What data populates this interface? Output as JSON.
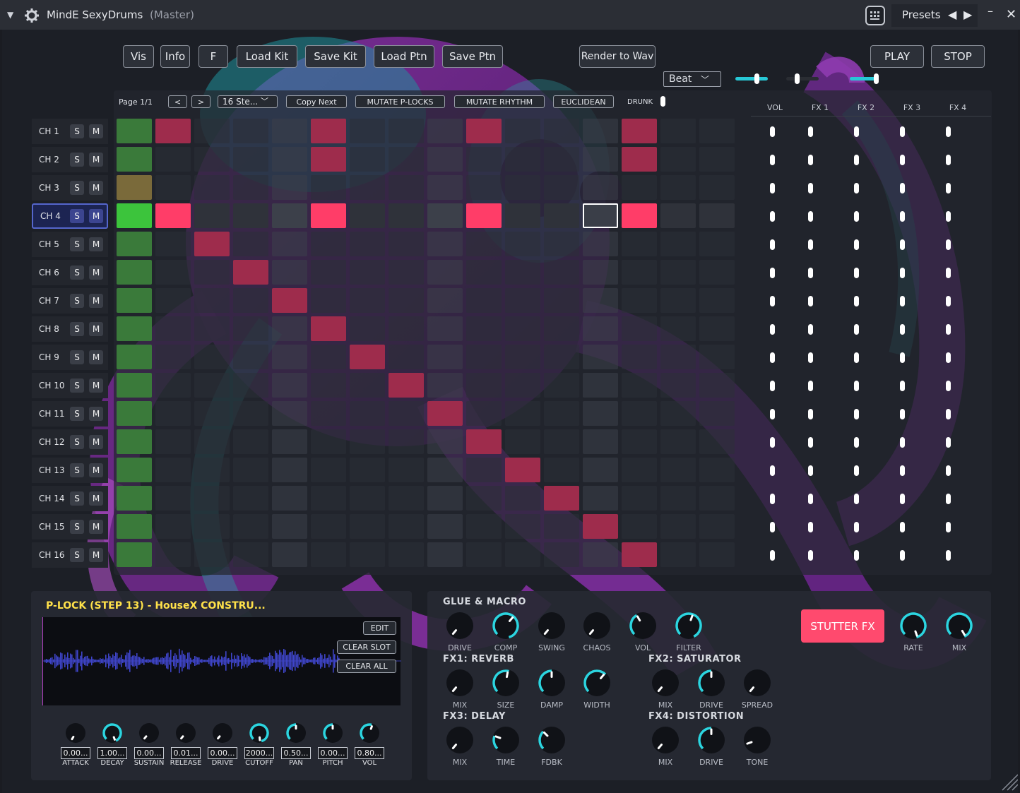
{
  "window": {
    "title": "MindE SexyDrums",
    "subtitle": "(Master)",
    "presets_label": "Presets"
  },
  "toolbar": {
    "buttons": [
      "Vis",
      "Info",
      "F",
      "Load Kit",
      "Save Kit",
      "Load Ptn",
      "Save Ptn",
      "Render to Wav",
      "PLAY",
      "STOP"
    ],
    "mode_select": "Beat"
  },
  "sequencer": {
    "page_label": "Page 1/1",
    "prev": "<",
    "next": ">",
    "steps_select": "16 Ste...",
    "copy_next": "Copy Next",
    "mutate_plocks": "MUTATE P-LOCKS",
    "mutate_rhythm": "MUTATE RHYTHM",
    "euclidean": "EUCLIDEAN",
    "drunk": "DRUNK",
    "mixer_headers": [
      "VOL",
      "FX 1",
      "FX 2",
      "FX 3",
      "FX 4"
    ],
    "channels": [
      "CH 1",
      "CH 2",
      "CH 3",
      "CH 4",
      "CH 5",
      "CH 6",
      "CH 7",
      "CH 8",
      "CH 9",
      "CH 10",
      "CH 11",
      "CH 12",
      "CH 13",
      "CH 14",
      "CH 15",
      "CH 16"
    ],
    "solo_label": "S",
    "mute_label": "M",
    "selected_channel": 4,
    "active_steps": [
      [
        1,
        5,
        9,
        13
      ],
      [
        5,
        13
      ],
      [],
      [
        1,
        5,
        9,
        13
      ],
      [
        2
      ],
      [
        3
      ],
      [
        4
      ],
      [
        5
      ],
      [
        6
      ],
      [
        7
      ],
      [
        8
      ],
      [
        9
      ],
      [
        10
      ],
      [
        11
      ],
      [
        12
      ],
      [
        13
      ]
    ],
    "highlighted_step": 13,
    "colors": {
      "step_on": "#9e2c4c",
      "step_on_selected": "#ff3d68",
      "step0": "#3a7a3a",
      "step0_selected": "#3cc43c",
      "step0_ch3": "#7a6a3a"
    }
  },
  "plock": {
    "title": "P-LOCK (STEP 13) - HouseX CONSTRU...",
    "edit": "EDIT",
    "clear_slot": "CLEAR SLOT",
    "clear_all": "CLEAR ALL",
    "params": [
      {
        "label": "ATTACK",
        "value": "0.00..."
      },
      {
        "label": "DECAY",
        "value": "1.00..."
      },
      {
        "label": "SUSTAIN",
        "value": "0.00..."
      },
      {
        "label": "RELEASE",
        "value": "0.01..."
      },
      {
        "label": "DRIVE",
        "value": "0.00..."
      },
      {
        "label": "CUTOFF",
        "value": "2000..."
      },
      {
        "label": "PAN",
        "value": "0.50..."
      },
      {
        "label": "PITCH",
        "value": "0.00..."
      },
      {
        "label": "VOL",
        "value": "0.80..."
      }
    ]
  },
  "fx": {
    "glue_title": "GLUE & MACRO",
    "glue_knobs": [
      "DRIVE",
      "COMP",
      "SWING",
      "CHAOS",
      "VOL",
      "FILTER"
    ],
    "reverb_title": "FX1: REVERB",
    "reverb_knobs": [
      "MIX",
      "SIZE",
      "DAMP",
      "WIDTH"
    ],
    "saturator_title": "FX2: SATURATOR",
    "saturator_knobs": [
      "MIX",
      "DRIVE",
      "SPREAD"
    ],
    "delay_title": "FX3: DELAY",
    "delay_knobs": [
      "MIX",
      "TIME",
      "FDBK"
    ],
    "distortion_title": "FX4: DISTORTION",
    "distortion_knobs": [
      "MIX",
      "DRIVE",
      "TONE"
    ],
    "stutter_label": "STUTTER FX",
    "stutter_knobs": [
      "RATE",
      "MIX"
    ]
  }
}
